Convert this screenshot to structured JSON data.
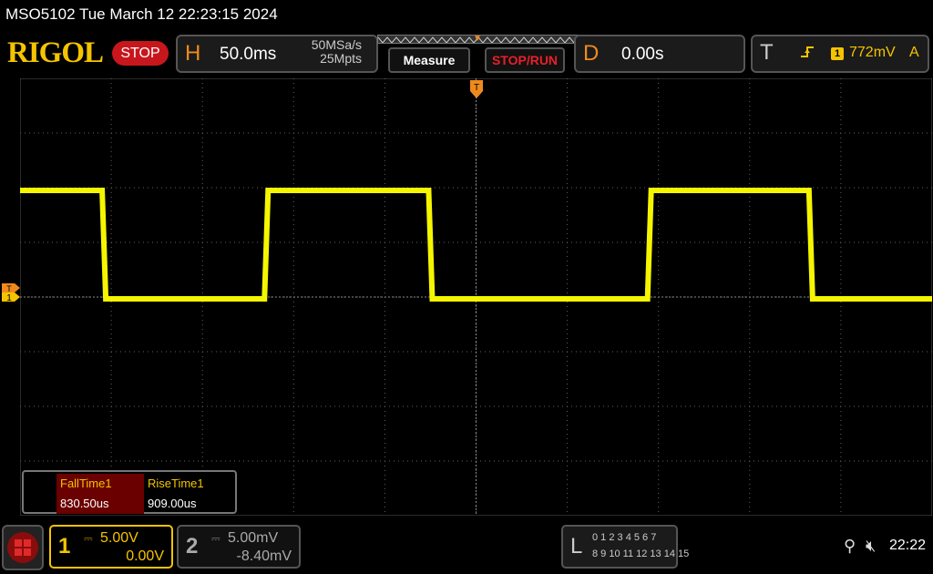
{
  "titlebar": {
    "text": "MSO5102  Tue March 12 22:23:15 2024"
  },
  "header": {
    "logo": "RIGOL",
    "run_state": "STOP",
    "horizontal": {
      "letter": "H",
      "timebase": "50.0ms",
      "sample_rate": "50MSa/s",
      "mem_depth": "25Mpts"
    },
    "measure_button": "Measure",
    "stoprun_button": "STOP/RUN",
    "delay": {
      "letter": "D",
      "value": "0.00s"
    },
    "trigger": {
      "letter": "T",
      "slope_icon": "rising-edge-icon",
      "source": "1",
      "level": "772mV",
      "mode": "A"
    }
  },
  "waveform": {
    "channel": 1,
    "color": "#f5f500",
    "high_level_label": "high",
    "transitions_in_divisions": [
      0.0,
      0.9,
      2.68,
      4.48,
      6.88,
      8.65,
      10.0
    ],
    "start_state": "high"
  },
  "markers": {
    "trigger_position": "T",
    "ch1_level": "1"
  },
  "measurements": [
    {
      "name": "FallTime1",
      "value": "830.50us"
    },
    {
      "name": "RiseTime1",
      "value": "909.00us"
    }
  ],
  "channels": [
    {
      "num": "1",
      "coupling_icon": "dc-coupling-icon",
      "scale": "5.00V",
      "offset": "0.00V",
      "color": "#f5c400"
    },
    {
      "num": "2",
      "coupling_icon": "dc-coupling-icon",
      "scale": "5.00mV",
      "offset": "-8.40mV",
      "color": "#aaaaaa"
    }
  ],
  "logic": {
    "letter": "L",
    "row1": "0 1 2 3  4 5 6 7",
    "row2": "8 9 10 11 12 13 14 15"
  },
  "status": {
    "usb_icon": "usb-icon",
    "mute_icon": "speaker-mute-icon",
    "clock": "22:22"
  }
}
